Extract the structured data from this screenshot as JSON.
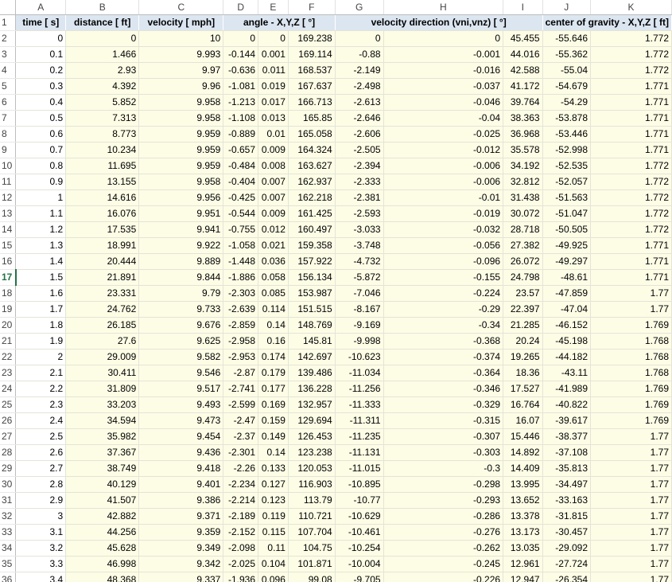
{
  "colors": {
    "header_fill": "#dce6f1",
    "cell_fill": "#fdfde6",
    "active_row": "#217346"
  },
  "columns": [
    "",
    "A",
    "B",
    "C",
    "D",
    "E",
    "F",
    "G",
    "H",
    "I",
    "J",
    "K"
  ],
  "headers": [
    "time [ s]",
    "distance [ ft]",
    "velocity [ mph]",
    "angle - X,Y,Z [ °]",
    "velocity direction (vni,vnz) [ °]",
    "center of gravity - X,Y,Z [ ft]"
  ],
  "active_row": "17",
  "rows": [
    [
      "2",
      "0",
      "0",
      "10",
      "0",
      "0",
      "169.238",
      "0",
      "0",
      "45.455",
      "-55.646",
      "1.772"
    ],
    [
      "3",
      "0.1",
      "1.466",
      "9.993",
      "-0.144",
      "0.001",
      "169.114",
      "-0.88",
      "-0.001",
      "44.016",
      "-55.362",
      "1.772"
    ],
    [
      "4",
      "0.2",
      "2.93",
      "9.97",
      "-0.636",
      "0.011",
      "168.537",
      "-2.149",
      "-0.016",
      "42.588",
      "-55.04",
      "1.772"
    ],
    [
      "5",
      "0.3",
      "4.392",
      "9.96",
      "-1.081",
      "0.019",
      "167.637",
      "-2.498",
      "-0.037",
      "41.172",
      "-54.679",
      "1.771"
    ],
    [
      "6",
      "0.4",
      "5.852",
      "9.958",
      "-1.213",
      "0.017",
      "166.713",
      "-2.613",
      "-0.046",
      "39.764",
      "-54.29",
      "1.771"
    ],
    [
      "7",
      "0.5",
      "7.313",
      "9.958",
      "-1.108",
      "0.013",
      "165.85",
      "-2.646",
      "-0.04",
      "38.363",
      "-53.878",
      "1.771"
    ],
    [
      "8",
      "0.6",
      "8.773",
      "9.959",
      "-0.889",
      "0.01",
      "165.058",
      "-2.606",
      "-0.025",
      "36.968",
      "-53.446",
      "1.771"
    ],
    [
      "9",
      "0.7",
      "10.234",
      "9.959",
      "-0.657",
      "0.009",
      "164.324",
      "-2.505",
      "-0.012",
      "35.578",
      "-52.998",
      "1.771"
    ],
    [
      "10",
      "0.8",
      "11.695",
      "9.959",
      "-0.484",
      "0.008",
      "163.627",
      "-2.394",
      "-0.006",
      "34.192",
      "-52.535",
      "1.772"
    ],
    [
      "11",
      "0.9",
      "13.155",
      "9.958",
      "-0.404",
      "0.007",
      "162.937",
      "-2.333",
      "-0.006",
      "32.812",
      "-52.057",
      "1.772"
    ],
    [
      "12",
      "1",
      "14.616",
      "9.956",
      "-0.425",
      "0.007",
      "162.218",
      "-2.381",
      "-0.01",
      "31.438",
      "-51.563",
      "1.772"
    ],
    [
      "13",
      "1.1",
      "16.076",
      "9.951",
      "-0.544",
      "0.009",
      "161.425",
      "-2.593",
      "-0.019",
      "30.072",
      "-51.047",
      "1.772"
    ],
    [
      "14",
      "1.2",
      "17.535",
      "9.941",
      "-0.755",
      "0.012",
      "160.497",
      "-3.033",
      "-0.032",
      "28.718",
      "-50.505",
      "1.772"
    ],
    [
      "15",
      "1.3",
      "18.991",
      "9.922",
      "-1.058",
      "0.021",
      "159.358",
      "-3.748",
      "-0.056",
      "27.382",
      "-49.925",
      "1.771"
    ],
    [
      "16",
      "1.4",
      "20.444",
      "9.889",
      "-1.448",
      "0.036",
      "157.922",
      "-4.732",
      "-0.096",
      "26.072",
      "-49.297",
      "1.771"
    ],
    [
      "17",
      "1.5",
      "21.891",
      "9.844",
      "-1.886",
      "0.058",
      "156.134",
      "-5.872",
      "-0.155",
      "24.798",
      "-48.61",
      "1.771"
    ],
    [
      "18",
      "1.6",
      "23.331",
      "9.79",
      "-2.303",
      "0.085",
      "153.987",
      "-7.046",
      "-0.224",
      "23.57",
      "-47.859",
      "1.77"
    ],
    [
      "19",
      "1.7",
      "24.762",
      "9.733",
      "-2.639",
      "0.114",
      "151.515",
      "-8.167",
      "-0.29",
      "22.397",
      "-47.04",
      "1.77"
    ],
    [
      "20",
      "1.8",
      "26.185",
      "9.676",
      "-2.859",
      "0.14",
      "148.769",
      "-9.169",
      "-0.34",
      "21.285",
      "-46.152",
      "1.769"
    ],
    [
      "21",
      "1.9",
      "27.6",
      "9.625",
      "-2.958",
      "0.16",
      "145.81",
      "-9.998",
      "-0.368",
      "20.24",
      "-45.198",
      "1.768"
    ],
    [
      "22",
      "2",
      "29.009",
      "9.582",
      "-2.953",
      "0.174",
      "142.697",
      "-10.623",
      "-0.374",
      "19.265",
      "-44.182",
      "1.768"
    ],
    [
      "23",
      "2.1",
      "30.411",
      "9.546",
      "-2.87",
      "0.179",
      "139.486",
      "-11.034",
      "-0.364",
      "18.36",
      "-43.11",
      "1.768"
    ],
    [
      "24",
      "2.2",
      "31.809",
      "9.517",
      "-2.741",
      "0.177",
      "136.228",
      "-11.256",
      "-0.346",
      "17.527",
      "-41.989",
      "1.769"
    ],
    [
      "25",
      "2.3",
      "33.203",
      "9.493",
      "-2.599",
      "0.169",
      "132.957",
      "-11.333",
      "-0.329",
      "16.764",
      "-40.822",
      "1.769"
    ],
    [
      "26",
      "2.4",
      "34.594",
      "9.473",
      "-2.47",
      "0.159",
      "129.694",
      "-11.311",
      "-0.315",
      "16.07",
      "-39.617",
      "1.769"
    ],
    [
      "27",
      "2.5",
      "35.982",
      "9.454",
      "-2.37",
      "0.149",
      "126.453",
      "-11.235",
      "-0.307",
      "15.446",
      "-38.377",
      "1.77"
    ],
    [
      "28",
      "2.6",
      "37.367",
      "9.436",
      "-2.301",
      "0.14",
      "123.238",
      "-11.131",
      "-0.303",
      "14.892",
      "-37.108",
      "1.77"
    ],
    [
      "29",
      "2.7",
      "38.749",
      "9.418",
      "-2.26",
      "0.133",
      "120.053",
      "-11.015",
      "-0.3",
      "14.409",
      "-35.813",
      "1.77"
    ],
    [
      "30",
      "2.8",
      "40.129",
      "9.401",
      "-2.234",
      "0.127",
      "116.903",
      "-10.895",
      "-0.298",
      "13.995",
      "-34.497",
      "1.77"
    ],
    [
      "31",
      "2.9",
      "41.507",
      "9.386",
      "-2.214",
      "0.123",
      "113.79",
      "-10.77",
      "-0.293",
      "13.652",
      "-33.163",
      "1.77"
    ],
    [
      "32",
      "3",
      "42.882",
      "9.371",
      "-2.189",
      "0.119",
      "110.721",
      "-10.629",
      "-0.286",
      "13.378",
      "-31.815",
      "1.77"
    ],
    [
      "33",
      "3.1",
      "44.256",
      "9.359",
      "-2.152",
      "0.115",
      "107.704",
      "-10.461",
      "-0.276",
      "13.173",
      "-30.457",
      "1.77"
    ],
    [
      "34",
      "3.2",
      "45.628",
      "9.349",
      "-2.098",
      "0.11",
      "104.75",
      "-10.254",
      "-0.262",
      "13.035",
      "-29.092",
      "1.77"
    ],
    [
      "35",
      "3.3",
      "46.998",
      "9.342",
      "-2.025",
      "0.104",
      "101.871",
      "-10.004",
      "-0.245",
      "12.961",
      "-27.724",
      "1.77"
    ],
    [
      "36",
      "3.4",
      "48.368",
      "9.337",
      "-1.936",
      "0.096",
      "99.08",
      "-9.705",
      "-0.226",
      "12.947",
      "-26.354",
      "1.77"
    ]
  ]
}
